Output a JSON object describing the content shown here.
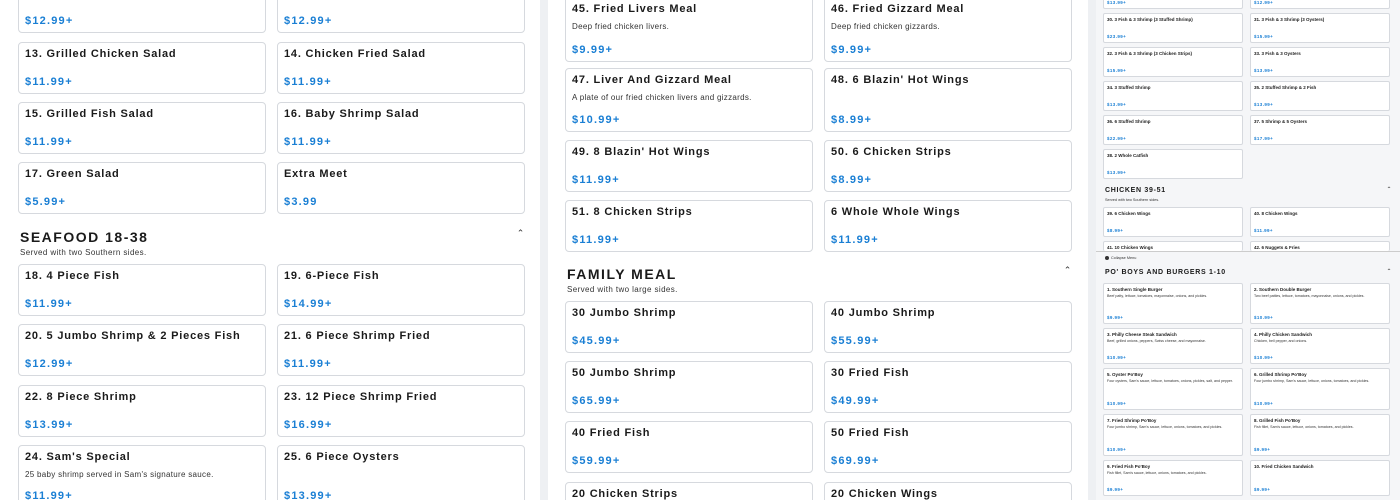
{
  "col1": {
    "items_top": [
      {
        "name": "",
        "price": "$12.99+"
      },
      {
        "name": "",
        "price": "$12.99+"
      },
      {
        "name": "13. Grilled Chicken Salad",
        "price": "$11.99+"
      },
      {
        "name": "14. Chicken Fried Salad",
        "price": "$11.99+"
      },
      {
        "name": "15. Grilled Fish Salad",
        "price": "$11.99+"
      },
      {
        "name": "16. Baby Shrimp Salad",
        "price": "$11.99+"
      },
      {
        "name": "17. Green Salad",
        "price": "$5.99+"
      },
      {
        "name": "Extra Meet",
        "price": "$3.99"
      }
    ],
    "seafood": {
      "title": "SEAFOOD 18-38",
      "subtitle": "Served with two Southern sides.",
      "items": [
        {
          "name": "18. 4 Piece Fish",
          "price": "$11.99+"
        },
        {
          "name": "19. 6-Piece Fish",
          "price": "$14.99+"
        },
        {
          "name": "20. 5 Jumbo Shrimp & 2 Pieces Fish",
          "price": "$12.99+"
        },
        {
          "name": "21. 6 Piece Shrimp Fried",
          "price": "$11.99+"
        },
        {
          "name": "22. 8 Piece Shrimp",
          "price": "$13.99+"
        },
        {
          "name": "23. 12 Piece Shrimp Fried",
          "price": "$16.99+"
        },
        {
          "name": "24. Sam's Special",
          "desc": "25 baby shrimp served in Sam's signature sauce.",
          "price": "$11.99+"
        },
        {
          "name": "25. 6 Piece Oysters",
          "price": "$13.99+"
        }
      ]
    }
  },
  "col2": {
    "items_top": [
      {
        "name": "45. Fried Livers Meal",
        "desc": "Deep fried chicken livers.",
        "price": "$9.99+"
      },
      {
        "name": "46. Fried Gizzard Meal",
        "desc": "Deep fried chicken gizzards.",
        "price": "$9.99+"
      },
      {
        "name": "47. Liver And Gizzard Meal",
        "desc": "A plate of our fried chicken livers and gizzards.",
        "price": "$10.99+"
      },
      {
        "name": "48. 6 Blazin' Hot Wings",
        "price": "$8.99+"
      },
      {
        "name": "49. 8 Blazin' Hot Wings",
        "price": "$11.99+"
      },
      {
        "name": "50. 6 Chicken Strips",
        "price": "$8.99+"
      },
      {
        "name": "51. 8 Chicken Strips",
        "price": "$11.99+"
      },
      {
        "name": "6 Whole Whole Wings",
        "price": "$11.99+"
      }
    ],
    "family": {
      "title": "FAMILY MEAL",
      "subtitle": "Served with two large sides.",
      "items": [
        {
          "name": "30 Jumbo Shrimp",
          "price": "$45.99+"
        },
        {
          "name": "40 Jumbo Shrimp",
          "price": "$55.99+"
        },
        {
          "name": "50 Jumbo Shrimp",
          "price": "$65.99+"
        },
        {
          "name": "30 Fried Fish",
          "price": "$49.99+"
        },
        {
          "name": "40 Fried Fish",
          "price": "$59.99+"
        },
        {
          "name": "50 Fried Fish",
          "price": "$69.99+"
        },
        {
          "name": "20 Chicken Strips",
          "price": ""
        },
        {
          "name": "20 Chicken Wings",
          "price": ""
        }
      ]
    }
  },
  "col3": {
    "top": [
      {
        "name": "",
        "price": "$13.99+"
      },
      {
        "name": "",
        "price": "$12.99+"
      },
      {
        "name": "30. 3 Fish & 3 Shrimp (3 Stuffed Shrimp)",
        "price": "$23.99+"
      },
      {
        "name": "31. 3 Fish & 3 Shrimp (3 Oysters)",
        "price": "$15.99+"
      },
      {
        "name": "32. 3 Fish & 3 Shrimp (3 Chicken Strips)",
        "price": "$15.99+"
      },
      {
        "name": "33. 3 Fish & 3 Oysters",
        "price": "$13.99+"
      },
      {
        "name": "34. 3 Stuffed Shrimp",
        "price": "$13.99+"
      },
      {
        "name": "35. 2 Stuffed Shrimp & 2 Fish",
        "price": "$13.99+"
      },
      {
        "name": "36. 6 Stuffed Shrimp",
        "price": "$22.99+"
      },
      {
        "name": "37. 5 Shrimp & 5 Oysters",
        "price": "$17.99+"
      },
      {
        "name": "38. 2 Whole Catfish",
        "price": "$13.99+"
      }
    ],
    "chicken": {
      "title": "CHICKEN 39-51",
      "subtitle": "Served with two Southern sides.",
      "items": [
        {
          "name": "39. 6 Chicken Wings",
          "price": "$8.99+"
        },
        {
          "name": "40. 8 Chicken Wings",
          "price": "$11.99+"
        },
        {
          "name": "41. 10 Chicken Wings",
          "price": ""
        },
        {
          "name": "42. 6 Nuggets & Fries",
          "price": ""
        }
      ]
    },
    "collapse_label": "Collapse Menu",
    "burgers": {
      "title": "PO' BOYS AND BURGERS 1-10",
      "items": [
        {
          "name": "1. Southern Single Burger",
          "desc": "Beef patty, lettuce, tomatoes, mayonnaise, onions, and pickles.",
          "price": "$9.99+"
        },
        {
          "name": "2. Southern Double Burger",
          "desc": "Two beef patties, lettuce, tomatoes, mayonnaise, onions, and pickles.",
          "price": "$10.99+"
        },
        {
          "name": "3. Philly Cheese Steak Sandwich",
          "desc": "Beef, grilled onions, peppers, Swiss cheese, and mayonnaise.",
          "price": "$10.99+"
        },
        {
          "name": "4. Philly Chicken Sandwich",
          "desc": "Chicken, bell pepper, and onions.",
          "price": "$10.99+"
        },
        {
          "name": "5. Oyster Po'Boy",
          "desc": "Four oysters, Sam's sauce, lettuce, tomatoes, onions, pickles, salt, and pepper.",
          "price": "$10.99+"
        },
        {
          "name": "6. Grilled Shrimp Po'Boy",
          "desc": "Four jumbo shrimp, Sam's sauce, lettuce, onions, tomatoes, and pickles.",
          "price": "$10.99+"
        },
        {
          "name": "7. Fried Shrimp Po'Boy",
          "desc": "Four jumbo shrimp, Sam's sauce, lettuce, onions, tomatoes, and pickles.",
          "price": "$10.99+"
        },
        {
          "name": "8. Grilled Fish Po'Boy",
          "desc": "Fish fillet, Sam's sauce, lettuce, onions, tomatoes, and pickles.",
          "price": "$9.99+"
        },
        {
          "name": "9. Fried Fish Po'Boy",
          "desc": "Fish fillet, Sam's sauce, lettuce, onions, tomatoes, and pickles.",
          "price": "$9.99+"
        },
        {
          "name": "10. Fried Chicken Sandwich",
          "desc": "",
          "price": "$9.99+"
        }
      ]
    }
  }
}
